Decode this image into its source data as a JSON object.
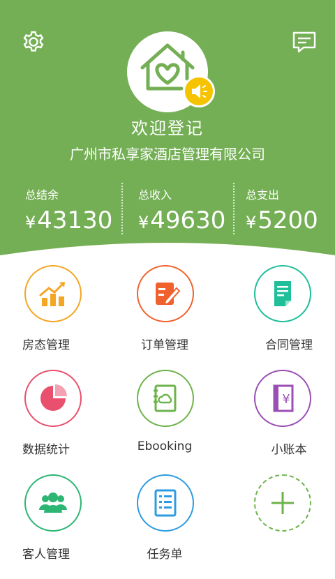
{
  "header": {
    "welcome": "欢迎登记",
    "company": "广州市私享家酒店管理有限公司",
    "bg_color": "#74af55"
  },
  "stats": [
    {
      "label": "总结余",
      "currency": "¥",
      "amount": "43130"
    },
    {
      "label": "总收入",
      "currency": "¥",
      "amount": "49630"
    },
    {
      "label": "总支出",
      "currency": "¥",
      "amount": "5200"
    }
  ],
  "grid": [
    {
      "label": "房态管理",
      "icon": "bar-chart-icon",
      "color": "#f5a623"
    },
    {
      "label": "订单管理",
      "icon": "edit-document-icon",
      "color": "#f0622d"
    },
    {
      "label": "合同管理",
      "icon": "contract-icon",
      "color": "#1fbf9a"
    },
    {
      "label": "数据统计",
      "icon": "pie-chart-icon",
      "color": "#e8506e"
    },
    {
      "label": "Ebooking",
      "icon": "cloud-book-icon",
      "color": "#6db34b"
    },
    {
      "label": "小账本",
      "icon": "ledger-icon",
      "color": "#9b4fb5"
    },
    {
      "label": "客人管理",
      "icon": "guests-icon",
      "color": "#2db574"
    },
    {
      "label": "任务单",
      "icon": "task-list-icon",
      "color": "#2d9be0"
    },
    {
      "label": "",
      "icon": "add-icon",
      "color": "#6db34b"
    }
  ]
}
